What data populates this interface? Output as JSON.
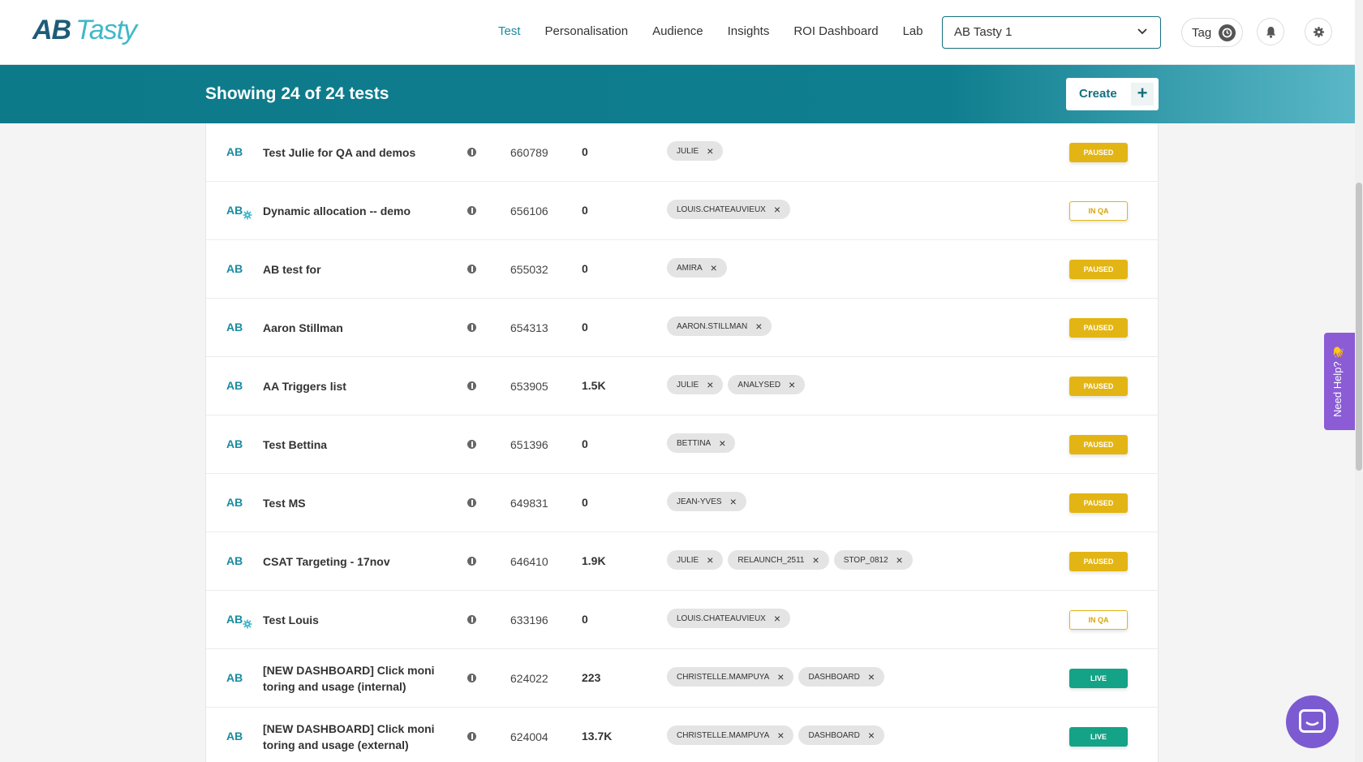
{
  "brand": {
    "logo_part1": "AB",
    "logo_part2": "Tasty"
  },
  "nav": {
    "items": [
      {
        "label": "Test",
        "active": true
      },
      {
        "label": "Personalisation",
        "active": false
      },
      {
        "label": "Audience",
        "active": false
      },
      {
        "label": "Insights",
        "active": false
      },
      {
        "label": "ROI Dashboard",
        "active": false
      },
      {
        "label": "Lab",
        "active": false
      }
    ],
    "account_selector": "AB Tasty 1",
    "tag_label": "Tag"
  },
  "header": {
    "title": "Showing 24 of 24 tests",
    "create_label": "Create",
    "create_icon": "+"
  },
  "tests": [
    {
      "type": "AB",
      "dynamic": false,
      "name": "Test Julie for QA and demos",
      "id": "660789",
      "visits": "0",
      "tags": [
        "JULIE"
      ],
      "status": "PAUSED"
    },
    {
      "type": "AB",
      "dynamic": true,
      "name": "Dynamic allocation -- demo",
      "id": "656106",
      "visits": "0",
      "tags": [
        "LOUIS.CHATEAUVIEUX"
      ],
      "status": "IN QA"
    },
    {
      "type": "AB",
      "dynamic": false,
      "name": "AB test for",
      "id": "655032",
      "visits": "0",
      "tags": [
        "AMIRA"
      ],
      "status": "PAUSED"
    },
    {
      "type": "AB",
      "dynamic": false,
      "name": "Aaron Stillman",
      "id": "654313",
      "visits": "0",
      "tags": [
        "AARON.STILLMAN"
      ],
      "status": "PAUSED"
    },
    {
      "type": "AB",
      "dynamic": false,
      "name": "AA Triggers list",
      "id": "653905",
      "visits": "1.5K",
      "tags": [
        "JULIE",
        "ANALYSED"
      ],
      "status": "PAUSED"
    },
    {
      "type": "AB",
      "dynamic": false,
      "name": "Test Bettina",
      "id": "651396",
      "visits": "0",
      "tags": [
        "BETTINA"
      ],
      "status": "PAUSED"
    },
    {
      "type": "AB",
      "dynamic": false,
      "name": "Test MS",
      "id": "649831",
      "visits": "0",
      "tags": [
        "JEAN-YVES"
      ],
      "status": "PAUSED"
    },
    {
      "type": "AB",
      "dynamic": false,
      "name": "CSAT Targeting - 17nov",
      "id": "646410",
      "visits": "1.9K",
      "tags": [
        "JULIE",
        "RELAUNCH_2511",
        "STOP_0812"
      ],
      "status": "PAUSED"
    },
    {
      "type": "AB",
      "dynamic": true,
      "name": "Test Louis",
      "id": "633196",
      "visits": "0",
      "tags": [
        "LOUIS.CHATEAUVIEUX"
      ],
      "status": "IN QA"
    },
    {
      "type": "AB",
      "dynamic": false,
      "name": "[NEW DASHBOARD] Click moni toring and usage (internal)",
      "id": "624022",
      "visits": "223",
      "tags": [
        "CHRISTELLE.MAMPUYA",
        "DASHBOARD"
      ],
      "status": "LIVE"
    },
    {
      "type": "AB",
      "dynamic": false,
      "name": "[NEW DASHBOARD] Click moni toring and usage (external)",
      "id": "624004",
      "visits": "13.7K",
      "tags": [
        "CHRISTELLE.MAMPUYA",
        "DASHBOARD"
      ],
      "status": "LIVE"
    }
  ],
  "help": {
    "label": "Need Help? 👋"
  },
  "colors": {
    "brand": "#1d5c79",
    "accent": "#1a8ba0",
    "paused": "#e3b514",
    "live": "#14a386",
    "help": "#8b5cd6"
  }
}
